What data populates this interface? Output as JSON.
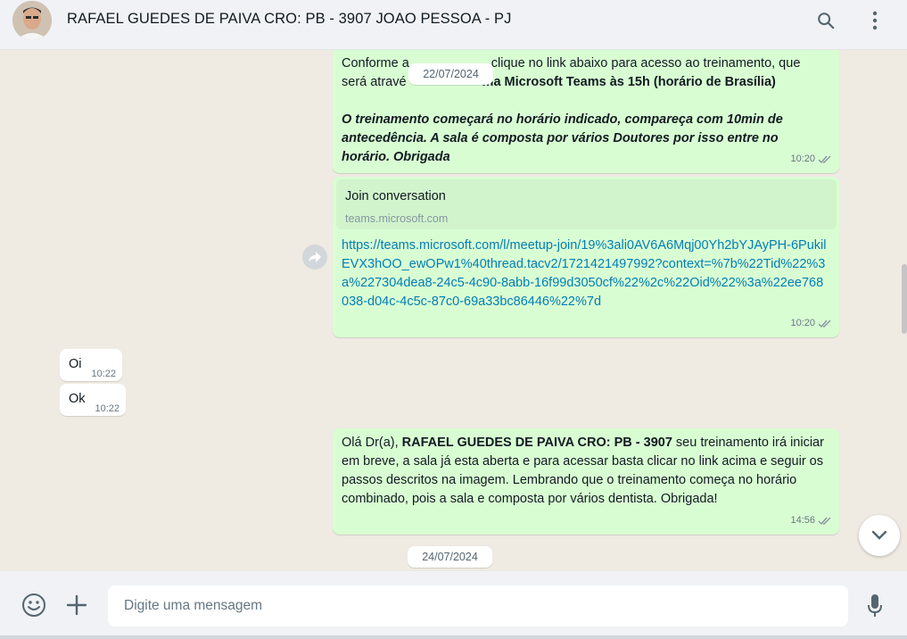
{
  "header": {
    "contact_name": "RAFAEL GUEDES DE PAIVA CRO: PB - 3907 JOAO PESSOA - PJ",
    "icons": [
      "search-icon",
      "menu-icon"
    ]
  },
  "chat": {
    "date_pill_1": "22/07/2024",
    "date_pill_2": "24/07/2024",
    "msg1": {
      "line1": "Conforme a",
      "line1_rest": "clique no link abaixo para acesso ao treinamento, que",
      "line2_start": "será atravé",
      "line2_bold": "ma Microsoft Teams às 15h (horário de Brasília)",
      "italic_1": "O treinamento começará no horário indicado, compareça com 10min de",
      "italic_2": "antecedência. A sala é composta por vários Doutores por isso entre no",
      "italic_3": "horário. Obrigada",
      "time": "10:20"
    },
    "msg2": {
      "preview_title": "Join conversation",
      "preview_domain": "teams.microsoft.com",
      "link": "https://teams.microsoft.com/l/meetup-join/19%3ali0AV6A6Mqj00Yh2bYJAyPH-6PukilEVX3hOO_ewOPw1%40thread.tacv2/1721421497992?context=%7b%22Tid%22%3a%227304dea8-24c5-4c90-8abb-16f99d3050cf%22%2c%22Oid%22%3a%22ee768038-d04c-4c5c-87c0-69a33bc86446%22%7d",
      "time": "10:20"
    },
    "in1": {
      "text": "Oi",
      "time": "10:22"
    },
    "in2": {
      "text": "Ok",
      "time": "10:22"
    },
    "msg3": {
      "prefix": "Olá Dr(a), ",
      "bold": "RAFAEL GUEDES DE PAIVA CRO: PB - 3907",
      "rest": " seu treinamento irá iniciar em breve, a sala já esta aberta e para acessar basta clicar no link acima e seguir os passos descritos na imagem. Lembrando que o treinamento começa no horário combinado, pois a sala e composta por vários dentista. Obrigada!",
      "time": "14:56"
    }
  },
  "footer": {
    "placeholder": "Digite uma mensagem",
    "icons": [
      "emoji-icon",
      "plus-icon",
      "microphone-icon"
    ]
  },
  "colors": {
    "outgoing_bubble": "#d9fdd3",
    "incoming_bubble": "#ffffff",
    "chat_background": "#efeae2",
    "link": "#027eb5",
    "read_ticks": "#8696a0"
  }
}
